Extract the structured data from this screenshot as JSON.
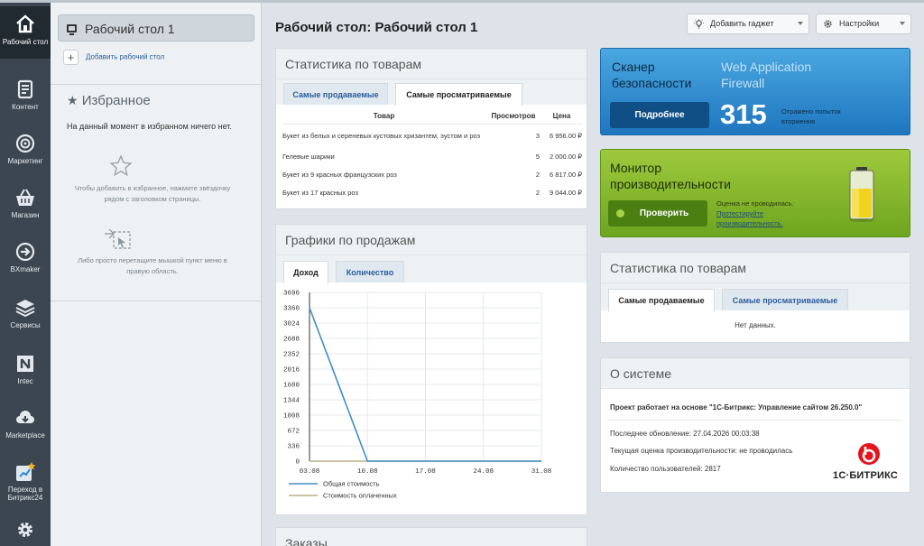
{
  "leftbar": {
    "items": [
      {
        "label": "Рабочий стол",
        "icon": "home-icon"
      },
      {
        "label": "Контент",
        "icon": "document-icon"
      },
      {
        "label": "Маркетинг",
        "icon": "target-icon"
      },
      {
        "label": "Магазин",
        "icon": "basket-icon"
      },
      {
        "label": "BXmaker",
        "icon": "arrow-circle-icon"
      },
      {
        "label": "Сервисы",
        "icon": "layers-icon"
      },
      {
        "label": "Intec",
        "icon": "intec-logo-icon"
      },
      {
        "label": "Marketplace",
        "icon": "cloud-download-icon"
      },
      {
        "label": "Переход в Битрикс24",
        "icon": "bitrix24-icon"
      }
    ],
    "settings_icon": "gear-icon"
  },
  "sidebar": {
    "desktop_label": "Рабочий стол 1",
    "add_desktop": "Добавить рабочий стол",
    "favorites_title": "Избранное",
    "favorites_empty": "На данный момент в избранном ничего нет.",
    "hint1": "Чтобы добавить в избранное, нажмите звёздочку рядом с заголовком страницы.",
    "hint2": "Либо просто перетащите мышкой пункт меню в правую область."
  },
  "header": {
    "title": "Рабочий стол: Рабочий стол 1",
    "add_gadget": "Добавить гаджет",
    "settings": "Настройки"
  },
  "stats_left": {
    "title": "Статистика по товарам",
    "tabs": [
      "Самые продаваемые",
      "Самые просматриваемые"
    ],
    "columns": [
      "Товар",
      "Просмотров",
      "Цена"
    ],
    "rows": [
      {
        "name": "Букет из белых и сереневых кустовых хризантем, эустом и роз",
        "views": "3",
        "price": "6 956.00 ₽"
      },
      {
        "name": "Гелевые шарики",
        "views": "5",
        "price": "2 000.00 ₽"
      },
      {
        "name": "Букет из 9 красных французских роз",
        "views": "2",
        "price": "6 817.00 ₽"
      },
      {
        "name": "Букет из 17 красных роз",
        "views": "2",
        "price": "9 044.00 ₽"
      }
    ]
  },
  "sales_chart": {
    "title": "Графики по продажам",
    "tabs": [
      "Доход",
      "Количество"
    ]
  },
  "chart_data": {
    "type": "line",
    "categories": [
      "03.08",
      "10.08",
      "17.08",
      "24.08",
      "31.08"
    ],
    "series": [
      {
        "name": "Общая стоимость",
        "color": "#3f8fc2",
        "values": [
          3360,
          0,
          0,
          0,
          0
        ]
      },
      {
        "name": "Стоимость оплаченных",
        "color": "#b8ae86",
        "values": [
          0,
          0,
          0,
          0,
          0
        ]
      }
    ],
    "yticks": [
      3696,
      3360,
      3024,
      2688,
      2352,
      2016,
      1680,
      1344,
      1008,
      672,
      336,
      0
    ],
    "ylim": [
      0,
      3696
    ],
    "grid": true,
    "legend": "bottom-left"
  },
  "orders": {
    "title": "Заказы"
  },
  "scanner": {
    "title": "Сканер безопасности",
    "subtitle": "Web Application Firewall",
    "button": "Подробнее",
    "count": "315",
    "count_label": "Отражено попыток вторжения"
  },
  "monitor": {
    "title": "Монитор производительности",
    "button": "Проверить",
    "note": "Оценка не проводилась.",
    "link": "Протестируйте производительность."
  },
  "stats_right": {
    "title": "Статистика по товарам",
    "tabs": [
      "Самые продаваемые",
      "Самые просматриваемые"
    ],
    "empty": "Нет данных."
  },
  "about": {
    "title": "О системе",
    "project": "Проект работает на основе \"1С-Битрикс: Управление сайтом 26.250.0\"",
    "last_update": "Последнее обновление: 27.04.2026 00:03:38",
    "performance": "Текущая оценка производительности: не проводилась",
    "users": "Количество пользователей: 2817",
    "logo_text": "1С·БИТРИКС"
  }
}
